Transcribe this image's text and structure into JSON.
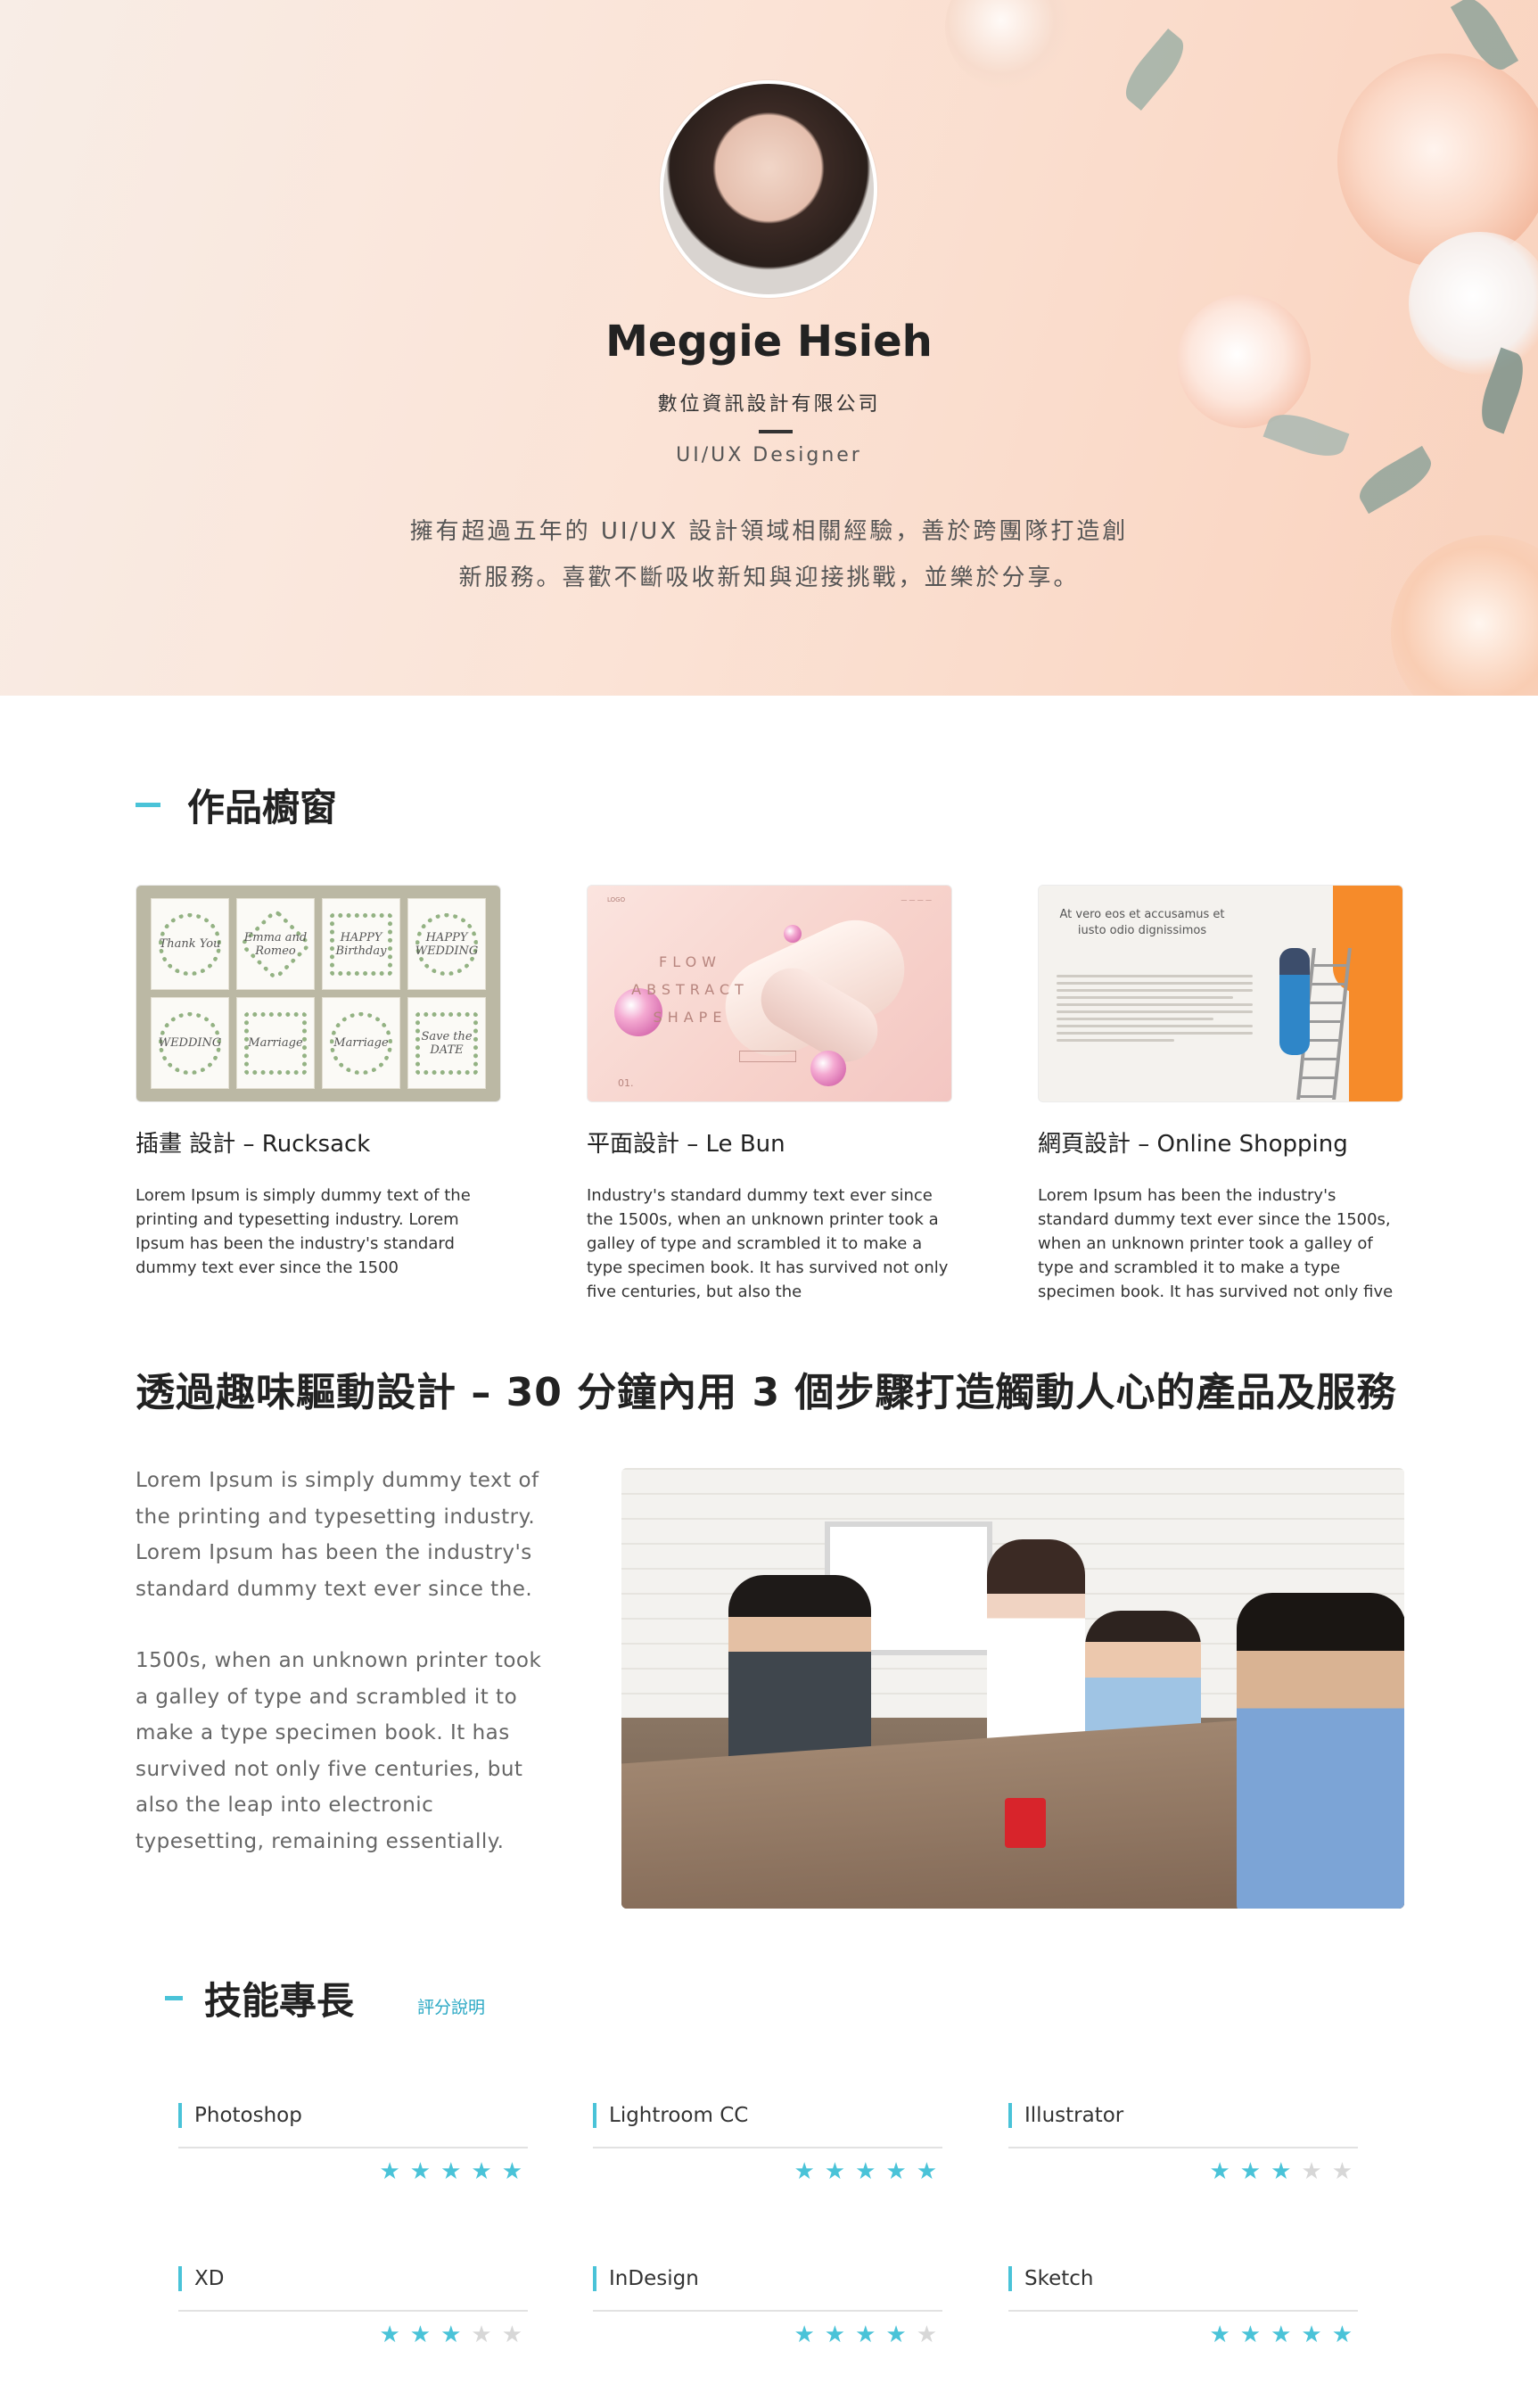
{
  "profile": {
    "name": "Meggie Hsieh",
    "company": "數位資訊設計有限公司",
    "title": "UI/UX Designer",
    "bio_line1": "擁有超過五年的 UI/UX 設計領域相關經驗，善於跨團隊打造創",
    "bio_line2": "新服務。喜歡不斷吸收新知與迎接挑戰，並樂於分享。"
  },
  "portfolio": {
    "heading": "作品櫥窗",
    "cards": [
      {
        "title": "插畫 設計 – Rucksack",
        "description": "Lorem Ipsum is simply dummy text of the printing and typesetting industry. Lorem Ipsum has been the industry's standard dummy text ever since the 1500",
        "thumb_texts": [
          "Thank You",
          "Emma and Romeo",
          "HAPPY Birthday",
          "HAPPY WEDDING",
          "WEDDING",
          "Marriage",
          "Marriage",
          "Save the DATE"
        ]
      },
      {
        "title": "平面設計 – Le Bun",
        "description": "Industry's standard dummy text ever since the 1500s, when an unknown printer took a galley of type and scrambled it to make a type specimen book. It has survived not only five centuries, but also the",
        "thumb_text_line1": "FLOW",
        "thumb_text_line2": "ABSTRACT",
        "thumb_text_line3": "SHAPE",
        "thumb_number": "01.",
        "thumb_logo": "LOGO"
      },
      {
        "title": "網頁設計 – Online Shopping",
        "description": "Lorem Ipsum has been the industry's standard dummy text ever since the 1500s, when an unknown printer took a galley of type and scrambled it to make a type specimen book. It has survived not only five",
        "thumb_heading": "At vero eos et accusamus et iusto odio dignissimos"
      }
    ]
  },
  "feature": {
    "heading": "透過趣味驅動設計 – 30 分鐘內用 3 個步驟打造觸動人心的產品及服務",
    "paragraph1": "Lorem Ipsum is simply dummy text of the printing and typesetting industry. Lorem Ipsum has been the industry's standard dummy text ever since the.",
    "paragraph2": "1500s, when an unknown printer took a galley of type and scrambled it to make a type specimen book. It has survived not only five centuries, but also the leap into electronic typesetting, remaining essentially."
  },
  "skills": {
    "heading": "技能專長",
    "rating_link": "評分說明",
    "max_rating": 5,
    "items": [
      {
        "name": "Photoshop",
        "rating": 5
      },
      {
        "name": "Lightroom CC",
        "rating": 5
      },
      {
        "name": "Illustrator",
        "rating": 3
      },
      {
        "name": "XD",
        "rating": 3
      },
      {
        "name": "InDesign",
        "rating": 4
      },
      {
        "name": "Sketch",
        "rating": 5
      }
    ]
  },
  "colors": {
    "accent": "#4ac3d8",
    "star_off": "#d7d7d7",
    "hero_bg": "#f9e3d7"
  }
}
